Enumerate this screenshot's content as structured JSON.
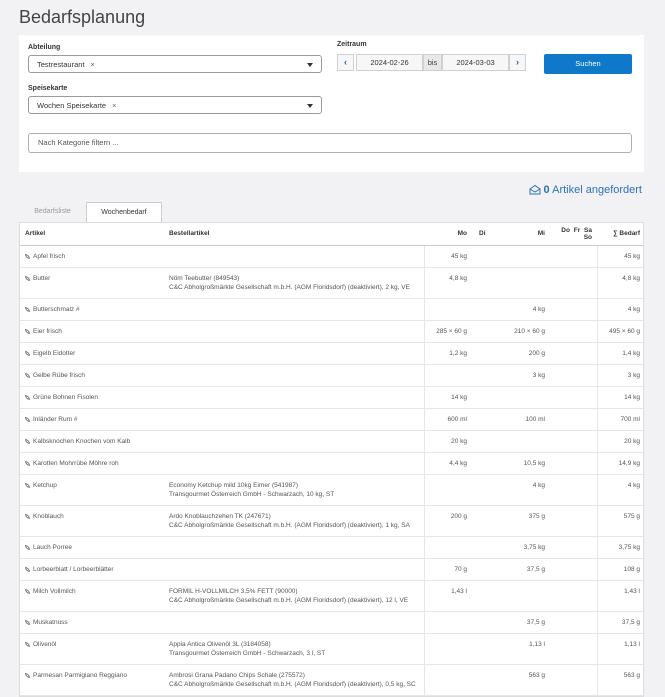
{
  "page": {
    "title": "Bedarfsplanung"
  },
  "filters": {
    "abteilung_label": "Abteilung",
    "abteilung_value": "Testrestaurant",
    "zeitraum_label": "Zeitraum",
    "date_from": "2024-02-26",
    "bis_label": "bis",
    "date_to": "2024-03-03",
    "search_label": "Suchen",
    "speisekarte_label": "Speisekarte",
    "speisekarte_value": "Wochen Speisekarte",
    "remove_glyph": "×",
    "kategorie_placeholder": "Nach Kategorie filtern ..."
  },
  "requested": {
    "count": "0",
    "label": "Artikel angefordert",
    "icon": "envelope-open-icon"
  },
  "tabs": [
    {
      "label": "Bedarfsliste",
      "active": false
    },
    {
      "label": "Wochenbedarf",
      "active": true
    }
  ],
  "table": {
    "headers": {
      "artikel": "Artikel",
      "bestellartikel": "Bestellartikel",
      "mo": "Mo",
      "di": "Di",
      "mi": "Mi",
      "do": "Do",
      "fr": "Fr",
      "sa": "Sa",
      "so": "So",
      "sum": "∑ Bedarf"
    },
    "rows": [
      {
        "artikel": "Apfel frisch",
        "bestell": "",
        "mo": "45 kg",
        "mi": "",
        "sum": "45 kg"
      },
      {
        "artikel": "Butter",
        "bestell": "Nöm Teebutter (849543)\nC&C Abholgroßmärkte Gesellschaft m.b.H. (AGM Floridsdorf) (deaktiviert), 2 kg, VE",
        "mo": "4,8 kg",
        "mi": "",
        "sum": "4,8 kg"
      },
      {
        "artikel": "Butterschmalz #",
        "bestell": "",
        "mo": "",
        "mi": "4 kg",
        "sum": "4 kg"
      },
      {
        "artikel": "Eier frisch",
        "bestell": "",
        "mo": "285 × 60 g",
        "mi": "210 × 60 g",
        "sum": "495 × 60 g"
      },
      {
        "artikel": "Eigelb Eidotter",
        "bestell": "",
        "mo": "1,2 kg",
        "mi": "200 g",
        "sum": "1,4 kg"
      },
      {
        "artikel": "Gelbe Rübe frisch",
        "bestell": "",
        "mo": "",
        "mi": "3 kg",
        "sum": "3 kg"
      },
      {
        "artikel": "Grüne Bohnen Fisolen",
        "bestell": "",
        "mo": "14 kg",
        "mi": "",
        "sum": "14 kg"
      },
      {
        "artikel": "Inländer Rum #",
        "bestell": "",
        "mo": "600 ml",
        "mi": "100 ml",
        "sum": "700 ml"
      },
      {
        "artikel": "Kalbsknochen Knochen vom Kalb",
        "bestell": "",
        "mo": "20 kg",
        "mi": "",
        "sum": "20 kg"
      },
      {
        "artikel": "Karotten Mohrrübe Möhre roh",
        "bestell": "",
        "mo": "4,4 kg",
        "mi": "10,5 kg",
        "sum": "14,9 kg"
      },
      {
        "artikel": "Ketchup",
        "bestell": "Economy Ketchup mild 10kg Eimer (541987)\nTransgourmet Österreich GmbH - Schwarzach, 10 kg, ST",
        "mo": "",
        "mi": "4 kg",
        "sum": "4 kg"
      },
      {
        "artikel": "Knoblauch",
        "bestell": "Ardo Knoblauchzehen TK (247671)\nC&C Abholgroßmärkte Gesellschaft m.b.H. (AGM Floridsdorf) (deaktiviert), 1 kg, SA",
        "mo": "200 g",
        "mi": "375 g",
        "sum": "575 g"
      },
      {
        "artikel": "Lauch Porree",
        "bestell": "",
        "mo": "",
        "mi": "3,75 kg",
        "sum": "3,75 kg"
      },
      {
        "artikel": "Lorbeerblatt / Lorbeerblätter",
        "bestell": "",
        "mo": "70 g",
        "mi": "37,5 g",
        "sum": "108 g"
      },
      {
        "artikel": "Milch Vollmilch",
        "bestell": "FORMIL H-VOLLMILCH 3,5% FETT (90000)\nC&C Abholgroßmärkte Gesellschaft m.b.H. (AGM Floridsdorf) (deaktiviert), 12 l, VE",
        "mo": "1,43 l",
        "mi": "",
        "sum": "1,43 l"
      },
      {
        "artikel": "Muskatnuss",
        "bestell": "",
        "mo": "",
        "mi": "37,5 g",
        "sum": "37,5 g"
      },
      {
        "artikel": "Olivenöl",
        "bestell": "Appia Antica Olivenöl 3L (3184058)\nTransgourmet Österreich GmbH - Schwarzach, 3 l, ST",
        "mo": "",
        "mi": "1,13 l",
        "sum": "1,13 l"
      },
      {
        "artikel": "Parmesan Parmigiano Reggiano",
        "bestell": "Ambrosi Grana Padano Chips Schale (275572)\nC&C Abholgroßmärkte Gesellschaft m.b.H. (AGM Floridsdorf) (deaktiviert), 0,5 kg, SC",
        "mo": "",
        "mi": "563 g",
        "sum": "563 g"
      }
    ]
  }
}
